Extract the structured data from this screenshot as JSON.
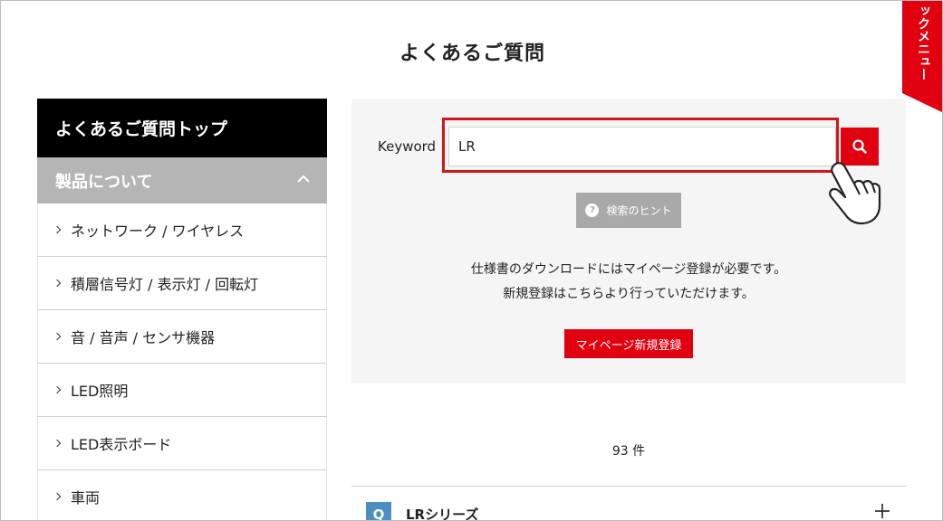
{
  "page": {
    "title": "よくあるご質問"
  },
  "quick_menu": {
    "label": "ックメニュー"
  },
  "sidebar": {
    "top_label": "よくあるご質問トップ",
    "section_label": "製品について",
    "items": [
      {
        "label": "ネットワーク / ワイヤレス"
      },
      {
        "label": "積層信号灯 / 表示灯 / 回転灯"
      },
      {
        "label": "音 / 音声 / センサ機器"
      },
      {
        "label": "LED照明"
      },
      {
        "label": "LED表示ボード"
      },
      {
        "label": "車両"
      }
    ]
  },
  "search": {
    "keyword_label": "Keyword",
    "value": "LR",
    "hint_label": "検索のヒント"
  },
  "notice": {
    "line1": "仕様書のダウンロードにはマイページ登録が必要です。",
    "line2": "新規登録はこちらより行っていただけます。",
    "register_label": "マイページ新規登録"
  },
  "results": {
    "count": "93 件",
    "items": [
      {
        "badge": "Q",
        "title": "LRシリーズ"
      }
    ]
  },
  "colors": {
    "accent_red": "#e00010",
    "highlight_red": "#d6141c",
    "badge_blue": "#4a90c2",
    "sidebar_black": "#000000",
    "section_gray": "#b5b5b5"
  }
}
